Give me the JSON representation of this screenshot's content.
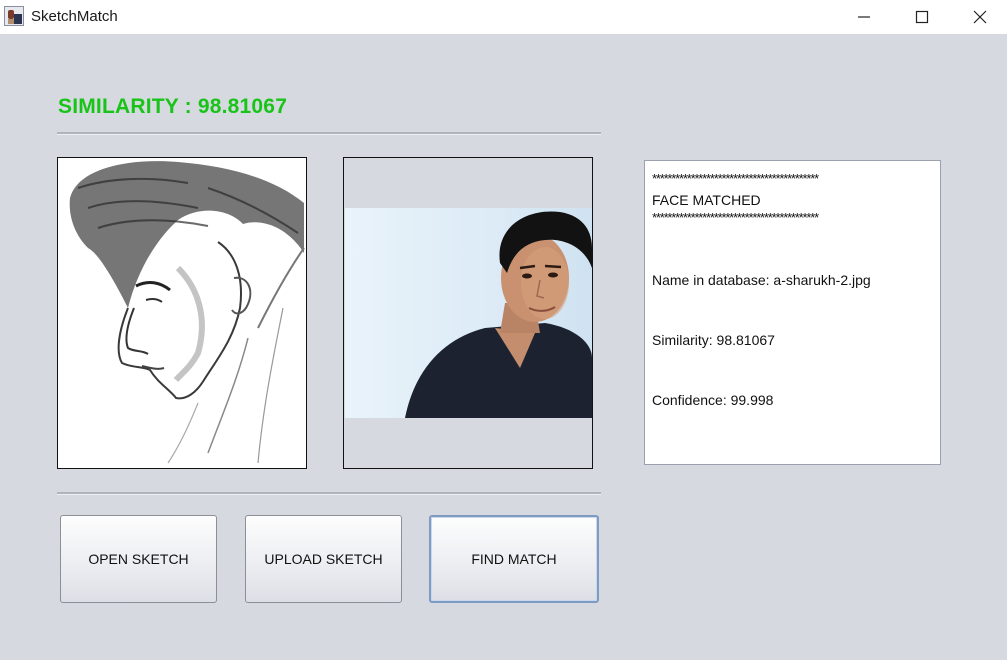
{
  "window": {
    "title": "SketchMatch",
    "controls": {
      "minimize": "minimize-icon",
      "maximize": "maximize-icon",
      "close": "close-icon"
    }
  },
  "header": {
    "similarity_title": "SIMILARITY : 98.81067",
    "title_color": "#19c419"
  },
  "images": {
    "sketch": "pencil sketch of a man's face",
    "photo": "photo of a man in a dark shirt"
  },
  "result": {
    "stars_top": "*******************************************",
    "status": "FACE MATCHED",
    "stars_bottom": "*******************************************",
    "name_line": "Name in database: a-sharukh-2.jpg",
    "similarity_line": "Similarity: 98.81067",
    "confidence_line": "Confidence: 99.998"
  },
  "buttons": {
    "open_sketch": "OPEN SKETCH",
    "upload_sketch": "UPLOAD SKETCH",
    "find_match": "FIND MATCH"
  }
}
